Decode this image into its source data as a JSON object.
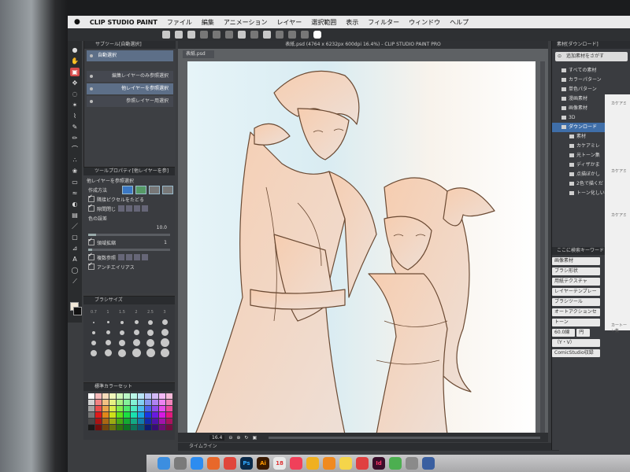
{
  "menubar": {
    "apple": "",
    "app_name": "CLIP STUDIO PAINT",
    "items": [
      "ファイル",
      "編集",
      "アニメーション",
      "レイヤー",
      "選択範囲",
      "表示",
      "フィルター",
      "ウィンドウ",
      "ヘルプ"
    ]
  },
  "document": {
    "title": "表紙.psd (4764 x 6232px 600dpi 16.4%)  - CLIP STUDIO PAINT PRO",
    "tab": "表紙.psd"
  },
  "subtool": {
    "title": "サブツール[自動選択]",
    "items": [
      {
        "label": "自動選択",
        "selected": true
      },
      {
        "label": "編集レイヤーのみ参照選択",
        "selected": false
      },
      {
        "label": "他レイヤーを参照選択",
        "selected": true
      },
      {
        "label": "参照レイヤー用選択",
        "selected": false
      }
    ]
  },
  "tool_property": {
    "title": "ツールプロパティ[他レイヤーを参]",
    "preset": "他レイヤーを参照選択",
    "mode_label": "作成方法",
    "rows": [
      {
        "label": "隣接ピクセルをたどる",
        "checked": true
      },
      {
        "label": "隙間閉じ",
        "checked": true
      },
      {
        "label": "色の誤差",
        "value": "10.0"
      },
      {
        "label": "領域拡縮",
        "checked": true,
        "value": "1"
      },
      {
        "label": "複数参照",
        "checked": true
      },
      {
        "label": "アンチエイリアス",
        "checked": true
      }
    ]
  },
  "brush_size": {
    "title": "ブラシサイズ",
    "sizes": [
      "0.7",
      "1",
      "1.5",
      "2",
      "2.5",
      "3"
    ]
  },
  "color_set": {
    "title": "標準カラーセット"
  },
  "zoom": {
    "value": "16.4"
  },
  "timeline": {
    "title": "タイムライン"
  },
  "materials": {
    "title": "素材[ダウンロード]",
    "search_placeholder": "追加素材をさがす",
    "tree": [
      {
        "label": "すべての素材",
        "selected": false
      },
      {
        "label": "カラーパターン",
        "selected": false
      },
      {
        "label": "単色パターン",
        "selected": false
      },
      {
        "label": "漫画素材",
        "selected": false
      },
      {
        "label": "画像素材",
        "selected": false
      },
      {
        "label": "3D",
        "selected": false
      },
      {
        "label": "ダウンロード",
        "selected": true
      },
      {
        "label": "素材",
        "selected": false
      },
      {
        "label": "カケアミレ",
        "selected": false
      },
      {
        "label": "光トーン集",
        "selected": false
      },
      {
        "label": "ディザかま",
        "selected": false
      },
      {
        "label": "点描ぼかし",
        "selected": false
      },
      {
        "label": "2色で描くだ",
        "selected": false
      },
      {
        "label": "トーン化しい",
        "selected": false
      }
    ],
    "tags_title": "ここに検索キーワード",
    "tags": [
      "画像素材",
      "ブラシ形状",
      "用紙テクスチャ",
      "レイヤーテンプレー",
      "ブラシツール",
      "オートアクションセ",
      "トーン",
      "60.0線",
      "円",
      "（Y・V）",
      "ComicStudio収録"
    ],
    "preview_labels": [
      "カケアミ",
      "カケアミ",
      "カケアミ",
      "カートーン集"
    ]
  },
  "dock": {
    "apps": [
      "Finder",
      "Launchpad",
      "Safari",
      "Firefox",
      "Chrome",
      "Ps",
      "Ai",
      "18",
      "Music",
      "Photos",
      "Books",
      "Notes",
      "Calendar",
      "Id",
      "Maps",
      "Settings",
      "Clip"
    ]
  },
  "colors": {
    "accent": "#3f6ea8",
    "tool_active": "#d64a4a",
    "lineart": "#6b4a33"
  }
}
